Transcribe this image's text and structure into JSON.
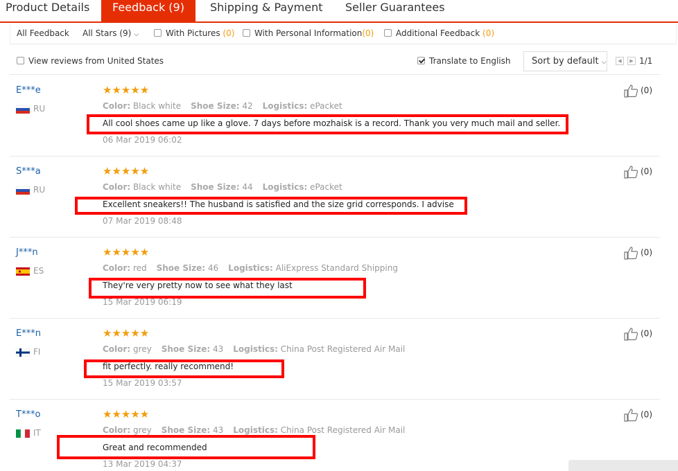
{
  "tabs": [
    {
      "label": "Product Details"
    },
    {
      "label": "Feedback (9)"
    },
    {
      "label": "Shipping & Payment"
    },
    {
      "label": "Seller Guarantees"
    }
  ],
  "filters": {
    "all_feedback": "All Feedback",
    "all_stars": "All Stars (9)",
    "with_pictures": "With Pictures",
    "with_pictures_count": "(0)",
    "with_personal": "With Personal Information",
    "with_personal_count": "(0)",
    "additional": "Additional Feedback",
    "additional_count": "(0)",
    "view_us": "View reviews from United States",
    "translate": "Translate to English",
    "sort": "Sort by default",
    "page": "1/1"
  },
  "reviews": [
    {
      "user": "E***e",
      "country": "RU",
      "stars": "★★★★★",
      "color_label": "Color:",
      "color": "Black white",
      "size_label": "Shoe Size:",
      "size": "42",
      "log_label": "Logistics:",
      "logistics": "ePacket",
      "text": "All cool shoes came up like a glove. 7 days before mozhaisk is a record. Thank you very much mail and seller.",
      "date": "06 Mar 2019 06:02",
      "likes": "(0)"
    },
    {
      "user": "S***a",
      "country": "RU",
      "stars": "★★★★★",
      "color_label": "Color:",
      "color": "Black white",
      "size_label": "Shoe Size:",
      "size": "44",
      "log_label": "Logistics:",
      "logistics": "ePacket",
      "text": "Excellent sneakers!! The husband is satisfied and the size grid corresponds. I advise",
      "date": "07 Mar 2019 08:48",
      "likes": "(0)"
    },
    {
      "user": "J***n",
      "country": "ES",
      "stars": "★★★★★",
      "color_label": "Color:",
      "color": "red",
      "size_label": "Shoe Size:",
      "size": "46",
      "log_label": "Logistics:",
      "logistics": "AliExpress Standard Shipping",
      "text": "They're very pretty now to see what they last",
      "date": "15 Mar 2019 06:19",
      "likes": "(0)"
    },
    {
      "user": "E***n",
      "country": "FI",
      "stars": "★★★★★",
      "color_label": "Color:",
      "color": "grey",
      "size_label": "Shoe Size:",
      "size": "43",
      "log_label": "Logistics:",
      "logistics": "China Post Registered Air Mail",
      "text": "fit perfectly. really recommend!",
      "date": "15 Mar 2019 03:57",
      "likes": "(0)"
    },
    {
      "user": "T***o",
      "country": "IT",
      "stars": "★★★★★",
      "color_label": "Color:",
      "color": "grey",
      "size_label": "Shoe Size:",
      "size": "43",
      "log_label": "Logistics:",
      "logistics": "China Post Registered Air Mail",
      "text": "Great and recommended",
      "date": "13 Mar 2019 04:37",
      "likes": "(0)"
    }
  ],
  "colors": {
    "accent": "#e62e04",
    "star": "#f29d0c",
    "highlight": "#ff0000",
    "username": "#1a5fa8"
  }
}
